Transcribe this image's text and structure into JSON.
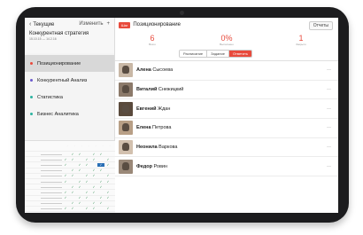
{
  "sidebar": {
    "back_label": "Текущие",
    "edit_label": "Изменить",
    "add_label": "+",
    "project_title": "Конкурентная стратегия",
    "project_dates": "15.10.15 — 14.2.16",
    "items": [
      {
        "label": "Позиционирование",
        "color": "#e84a3c",
        "active": true
      },
      {
        "label": "Конкурентный Анализ",
        "color": "#6a5acd",
        "active": false
      },
      {
        "label": "Статистика",
        "color": "#2bb3a0",
        "active": false
      },
      {
        "label": "Бизнес Аналитика",
        "color": "#2bb3a0",
        "active": false
      }
    ]
  },
  "header": {
    "tag": "Шаг",
    "title": "Позиционирование",
    "reports_button": "Отчеты"
  },
  "stats": [
    {
      "value": "6",
      "label": "Всего"
    },
    {
      "value": "0%",
      "label": "Выполнено"
    },
    {
      "value": "1",
      "label": "Закрыто"
    }
  ],
  "tabs": [
    "Расписание",
    "Задание",
    "Ответить"
  ],
  "active_tab": 2,
  "people": [
    {
      "first": "Алена",
      "last": "Сысоева"
    },
    {
      "first": "Виталий",
      "last": "Снежицкий"
    },
    {
      "first": "Евгений",
      "last": "Ждан"
    },
    {
      "first": "Елена",
      "last": "Петрова"
    },
    {
      "first": "Неонила",
      "last": "Варкова"
    },
    {
      "first": "Федор",
      "last": "Ровин"
    }
  ],
  "accent_color": "#e84a3c"
}
